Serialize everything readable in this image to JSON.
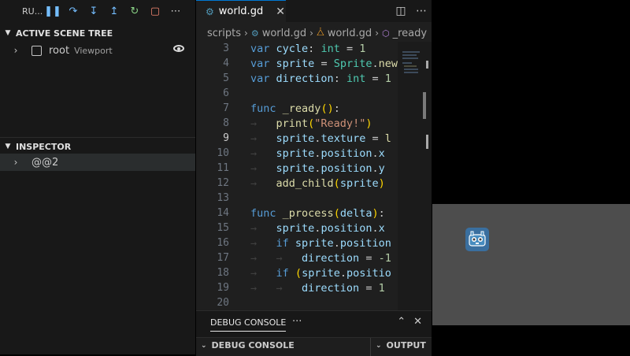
{
  "debug_toolbar": {
    "run_label": "RU...",
    "icons": [
      "pause-icon",
      "step-over-icon",
      "step-into-icon",
      "step-out-icon",
      "restart-icon",
      "stop-icon",
      "more-icon"
    ]
  },
  "scene_tree": {
    "title": "ACTIVE SCENE TREE",
    "items": [
      {
        "name": "root",
        "type": "Viewport"
      }
    ]
  },
  "inspector": {
    "title": "INSPECTOR",
    "items": [
      {
        "name": "@@2"
      }
    ]
  },
  "editor": {
    "tab_label": "world.gd",
    "breadcrumbs": [
      "scripts",
      "world.gd",
      "world.gd",
      "_ready"
    ],
    "current_line": 9,
    "lines": [
      {
        "n": "3",
        "text": "var cycle: int = 1"
      },
      {
        "n": "4",
        "text": "var sprite = Sprite.new"
      },
      {
        "n": "5",
        "text": "var direction: int = 1"
      },
      {
        "n": "6",
        "text": ""
      },
      {
        "n": "7",
        "text": "func _ready():"
      },
      {
        "n": "8",
        "text": "    print(\"Ready!\")"
      },
      {
        "n": "9",
        "text": "    sprite.texture = l"
      },
      {
        "n": "10",
        "text": "    sprite.position.x"
      },
      {
        "n": "11",
        "text": "    sprite.position.y"
      },
      {
        "n": "12",
        "text": "    add_child(sprite)"
      },
      {
        "n": "13",
        "text": ""
      },
      {
        "n": "14",
        "text": "func _process(delta):"
      },
      {
        "n": "15",
        "text": "    sprite.position.x"
      },
      {
        "n": "16",
        "text": "    if sprite.position"
      },
      {
        "n": "17",
        "text": "        direction = -1"
      },
      {
        "n": "18",
        "text": "    if (sprite.positio"
      },
      {
        "n": "19",
        "text": "        direction = 1"
      },
      {
        "n": "20",
        "text": ""
      }
    ]
  },
  "panel": {
    "tab": "DEBUG CONSOLE",
    "more": "···",
    "sections": [
      "DEBUG CONSOLE",
      "OUTPUT"
    ]
  },
  "colors": {
    "accent": "#0078d4",
    "sidebar_bg": "#181818",
    "editor_bg": "#1f1f1f",
    "game_bg": "#4d4d4d"
  }
}
